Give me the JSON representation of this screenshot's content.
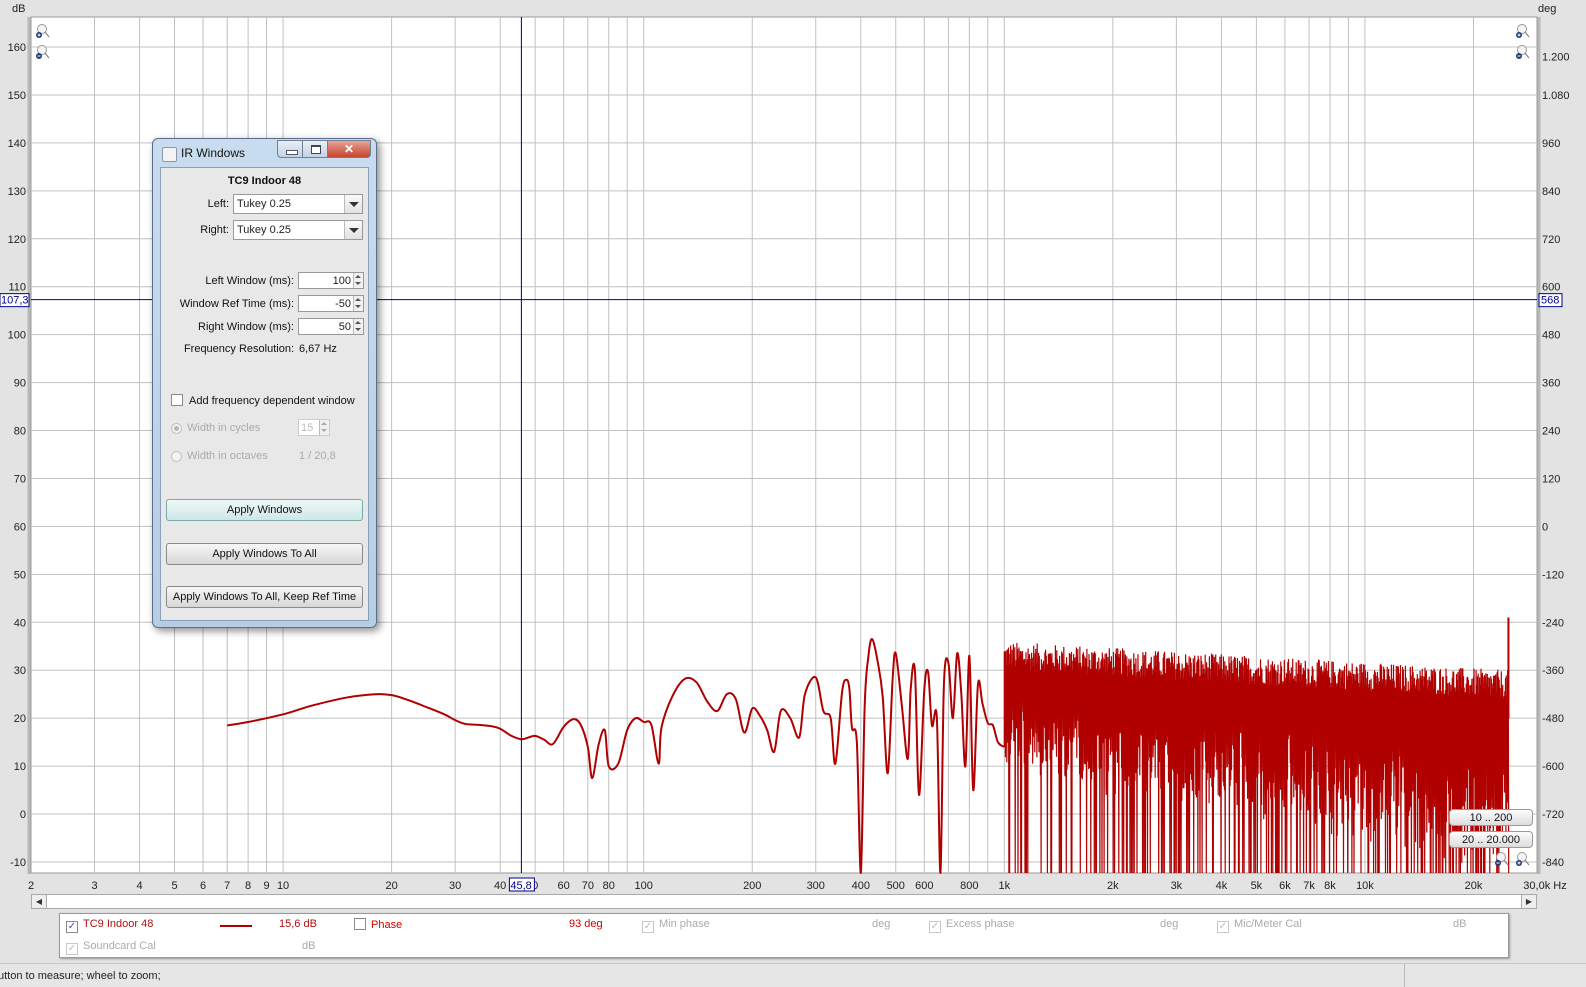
{
  "chart_data": {
    "type": "line",
    "title": "",
    "xlabel": "Hz",
    "ylabel": "dB",
    "y2label": "deg",
    "xscale": "log",
    "xlim": [
      2,
      30000
    ],
    "ylim": [
      -10,
      163
    ],
    "y2lim": [
      -840,
      1236
    ],
    "grid": true,
    "x_ticks": [
      {
        "v": 2,
        "l": "2"
      },
      {
        "v": 3,
        "l": "3"
      },
      {
        "v": 4,
        "l": "4"
      },
      {
        "v": 5,
        "l": "5"
      },
      {
        "v": 6,
        "l": "6"
      },
      {
        "v": 7,
        "l": "7"
      },
      {
        "v": 8,
        "l": "8"
      },
      {
        "v": 9,
        "l": "9"
      },
      {
        "v": 10,
        "l": "10"
      },
      {
        "v": 20,
        "l": "20"
      },
      {
        "v": 30,
        "l": "30"
      },
      {
        "v": 40,
        "l": "40"
      },
      {
        "v": 50,
        "l": "0"
      },
      {
        "v": 60,
        "l": "60"
      },
      {
        "v": 70,
        "l": "70"
      },
      {
        "v": 80,
        "l": "80"
      },
      {
        "v": 90,
        "l": ""
      },
      {
        "v": 100,
        "l": "100"
      },
      {
        "v": 200,
        "l": "200"
      },
      {
        "v": 300,
        "l": "300"
      },
      {
        "v": 400,
        "l": "400"
      },
      {
        "v": 500,
        "l": "500"
      },
      {
        "v": 600,
        "l": "600"
      },
      {
        "v": 700,
        "l": ""
      },
      {
        "v": 800,
        "l": "800"
      },
      {
        "v": 900,
        "l": ""
      },
      {
        "v": 1000,
        "l": "1k"
      },
      {
        "v": 2000,
        "l": "2k"
      },
      {
        "v": 3000,
        "l": "3k"
      },
      {
        "v": 4000,
        "l": "4k"
      },
      {
        "v": 5000,
        "l": "5k"
      },
      {
        "v": 6000,
        "l": "6k"
      },
      {
        "v": 7000,
        "l": "7k"
      },
      {
        "v": 8000,
        "l": "8k"
      },
      {
        "v": 9000,
        "l": ""
      },
      {
        "v": 10000,
        "l": "10k"
      },
      {
        "v": 20000,
        "l": "20k"
      },
      {
        "v": 30000,
        "l": "30,0k Hz"
      }
    ],
    "y_ticks": [
      160,
      150,
      140,
      130,
      120,
      110,
      100,
      90,
      80,
      70,
      60,
      50,
      40,
      30,
      20,
      10,
      0,
      -10
    ],
    "y2_ticks": [
      {
        "v": 160,
        "l": ""
      },
      {
        "v": 158,
        "l": "1.200"
      },
      {
        "v": 150,
        "l": "1.080"
      },
      {
        "v": 140,
        "l": "960"
      },
      {
        "v": 130,
        "l": "840"
      },
      {
        "v": 120,
        "l": "720"
      },
      {
        "v": 110,
        "l": "600"
      },
      {
        "v": 100,
        "l": "480"
      },
      {
        "v": 90,
        "l": "360"
      },
      {
        "v": 80,
        "l": "240"
      },
      {
        "v": 70,
        "l": "120"
      },
      {
        "v": 60,
        "l": "0"
      },
      {
        "v": 50,
        "l": "-120"
      },
      {
        "v": 40,
        "l": "-240"
      },
      {
        "v": 30,
        "l": "-360"
      },
      {
        "v": 20,
        "l": "-480"
      },
      {
        "v": 10,
        "l": "-600"
      },
      {
        "v": 0,
        "l": "-720"
      },
      {
        "v": -10,
        "l": "-840"
      }
    ],
    "cursor": {
      "x": 45.8,
      "x_label": "45,8",
      "y": 107.3,
      "y_label": "107,3",
      "y2_label": "568"
    },
    "series": [
      {
        "name": "TC9 Indoor 48",
        "color": "#b00000",
        "x": [
          7,
          8,
          10,
          12,
          15,
          18,
          20,
          22,
          25,
          28,
          30,
          32,
          35,
          38,
          40,
          43,
          45.8,
          48,
          50,
          53,
          56,
          60,
          64,
          67,
          70,
          72,
          75,
          78,
          80,
          85,
          90,
          95,
          100,
          105,
          110,
          112,
          120,
          130,
          140,
          150,
          160,
          170,
          180,
          190,
          200,
          210,
          220,
          230,
          240,
          255,
          270,
          280,
          300,
          315,
          330,
          340,
          355,
          365,
          372,
          378,
          390,
          400,
          410,
          420,
          430,
          445,
          460,
          475,
          490,
          500,
          520,
          540,
          550,
          565,
          580,
          600,
          615,
          630,
          650,
          665,
          680,
          700,
          720,
          740,
          760,
          780,
          800,
          820,
          845,
          870,
          900,
          930,
          960,
          1000
        ],
        "y": [
          18.5,
          19.2,
          20.8,
          22.6,
          24.3,
          25.0,
          24.8,
          23.9,
          22.3,
          20.8,
          19.6,
          18.8,
          18.6,
          18.3,
          17.8,
          16.3,
          15.6,
          16.0,
          16.3,
          15.5,
          14.6,
          18.2,
          19.8,
          18.5,
          14.0,
          7.5,
          14.5,
          17.5,
          10.0,
          10.5,
          17.5,
          20.0,
          19.2,
          18.6,
          10.5,
          18.0,
          24.5,
          28.2,
          27.5,
          23.5,
          21.5,
          25.0,
          24.0,
          17.0,
          22.0,
          20.5,
          17.5,
          13.0,
          21.5,
          20.0,
          16.0,
          25.0,
          28.5,
          21.5,
          20.0,
          10.5,
          25.5,
          28.0,
          26.0,
          18.0,
          15.0,
          -14.0,
          22.5,
          33.0,
          36.5,
          32.0,
          24.5,
          8.5,
          28.0,
          33.5,
          22.5,
          11.5,
          26.0,
          30.0,
          4.0,
          26.0,
          29.5,
          18.5,
          20.0,
          -14.0,
          27.0,
          31.5,
          20.0,
          33.5,
          25.0,
          10.0,
          33.0,
          5.0,
          27.0,
          23.0,
          19.0,
          18.5,
          15.0,
          14.0
        ]
      }
    ],
    "hf_noise": {
      "start_hz": 1000,
      "end_hz": 25000,
      "upper_db": 30,
      "lower_db": -12,
      "spike_hz": 25000,
      "spike_db": 41
    }
  },
  "y_axis": {
    "unit_left": "dB",
    "unit_right": "deg"
  },
  "range_buttons": [
    "10 .. 200",
    "20 .. 20.000"
  ],
  "dialog": {
    "title": "IR Windows",
    "measurement_name": "TC9 Indoor 48",
    "left_label": "Left:",
    "left_value": "Tukey 0.25",
    "right_label": "Right:",
    "right_value": "Tukey 0.25",
    "left_window_label": "Left Window (ms):",
    "left_window_value": "100",
    "ref_time_label": "Window Ref Time (ms):",
    "ref_time_value": "-50",
    "right_window_label": "Right Window (ms):",
    "right_window_value": "50",
    "freq_res_label": "Frequency Resolution:",
    "freq_res_value": "6,67 Hz",
    "fdw_label": "Add frequency dependent window",
    "fdw_checked": false,
    "width_cycles_label": "Width in cycles",
    "width_cycles_value": "15",
    "width_octaves_label": "Width in octaves",
    "width_octaves_value": "1 / 20,8",
    "apply_label": "Apply Windows",
    "apply_all_label": "Apply Windows To All",
    "apply_all_keep_label": "Apply Windows To All, Keep Ref Time"
  },
  "legend": {
    "row1": [
      {
        "label": "TC9 Indoor 48",
        "checked": true,
        "enabled": true,
        "value": "15,6 dB",
        "color": "#b00000"
      },
      {
        "label": "Phase",
        "checked": false,
        "enabled": true,
        "value": "93 deg",
        "color": "#e00000"
      },
      {
        "label": "Min phase",
        "checked": true,
        "enabled": false,
        "value": "deg"
      },
      {
        "label": "Excess phase",
        "checked": true,
        "enabled": false,
        "value": "deg"
      },
      {
        "label": "Mic/Meter Cal",
        "checked": true,
        "enabled": false,
        "value": "dB"
      }
    ],
    "row2": [
      {
        "label": "Soundcard Cal",
        "checked": true,
        "enabled": false,
        "value": "dB"
      }
    ]
  },
  "status": {
    "text": "utton to measure; wheel to zoom;"
  },
  "colors": {
    "curve": "#b00000",
    "cursor": "#00008b",
    "grid": "#c0c0c0"
  }
}
